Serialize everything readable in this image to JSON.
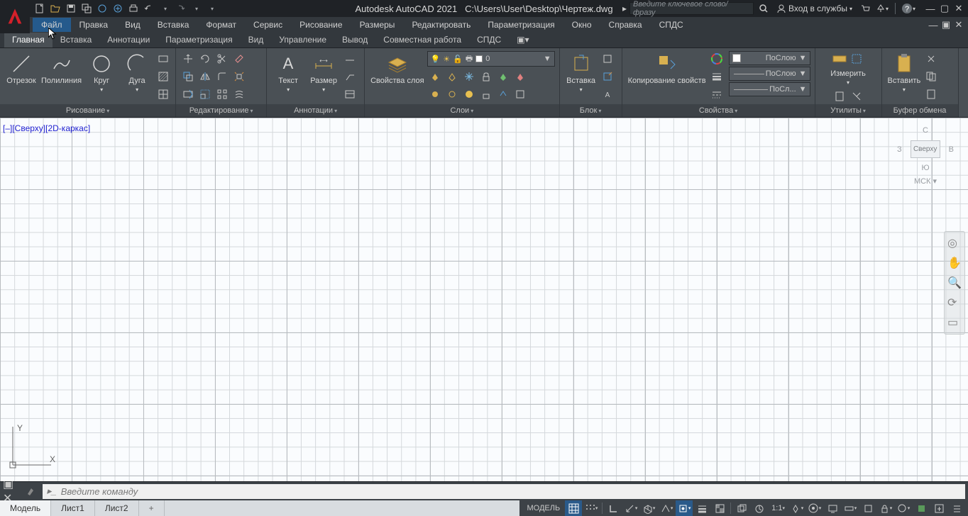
{
  "title": {
    "app": "Autodesk AutoCAD 2021",
    "path": "C:\\Users\\User\\Desktop\\Чертеж.dwg"
  },
  "search_placeholder": "Введите ключевое слово/фразу",
  "signin": "Вход в службы",
  "menus": [
    "Файл",
    "Правка",
    "Вид",
    "Вставка",
    "Формат",
    "Сервис",
    "Рисование",
    "Размеры",
    "Редактировать",
    "Параметризация",
    "Окно",
    "Справка",
    "СПДС"
  ],
  "ribbon_tabs": [
    "Главная",
    "Вставка",
    "Аннотации",
    "Параметризация",
    "Вид",
    "Управление",
    "Вывод",
    "Совместная работа",
    "СПДС"
  ],
  "panels": {
    "draw": {
      "title": "Рисование",
      "btns": {
        "line": "Отрезок",
        "pline": "Полилиния",
        "circle": "Круг",
        "arc": "Дуга"
      }
    },
    "modify": {
      "title": "Редактирование"
    },
    "anno": {
      "title": "Аннотации",
      "btns": {
        "text": "Текст",
        "dim": "Размер"
      }
    },
    "layers": {
      "title": "Слои",
      "props": "Свойства слоя",
      "current": "0"
    },
    "block": {
      "title": "Блок",
      "insert": "Вставка"
    },
    "props": {
      "title": "Свойства",
      "copy": "Копирование свойств",
      "bylayer": "ПоСлою",
      "bylayer2": "ПоСлою",
      "bylayer3": "ПоСл..."
    },
    "utils": {
      "title": "Утилиты",
      "measure": "Измерить"
    },
    "clip": {
      "title": "Буфер обмена",
      "paste": "Вставить"
    }
  },
  "viewport": {
    "controls": "[–][Сверху][2D-каркас]",
    "top": "Сверху",
    "wcs": "МСК",
    "n": "С",
    "s": "Ю",
    "e": "В",
    "w": "З"
  },
  "cmd_placeholder": "Введите команду",
  "bottom_tabs": [
    "Модель",
    "Лист1",
    "Лист2"
  ],
  "status": {
    "model": "МОДЕЛЬ",
    "scale": "1:1"
  }
}
